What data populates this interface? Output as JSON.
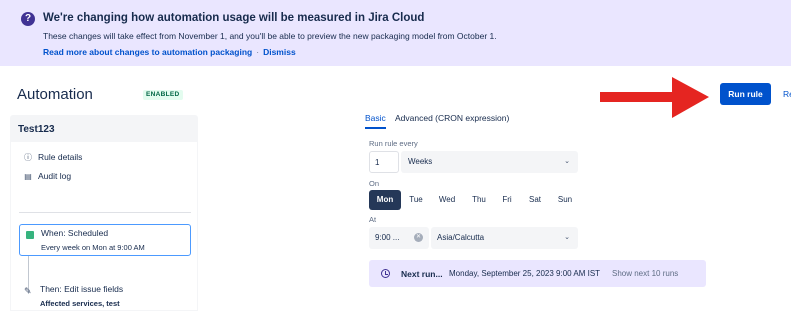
{
  "banner": {
    "icon": "question-icon",
    "title": "We're changing how automation usage will be measured in Jira Cloud",
    "description": "These changes will take effect from November 1, and you'll be able to preview the new packaging model from October 1.",
    "read_more": "Read more about changes to automation packaging",
    "separator": "·",
    "dismiss": "Dismiss"
  },
  "header": {
    "title": "Automation",
    "status": "ENABLED"
  },
  "rule": {
    "name": "Test123",
    "nav": [
      {
        "label": "Rule details",
        "icon": "info-icon"
      },
      {
        "label": "Audit log",
        "icon": "document-icon"
      }
    ],
    "trigger": {
      "title": "When: Scheduled",
      "subtitle": "Every week on Mon at 9:00 AM",
      "icon": "calendar-icon"
    },
    "action": {
      "title": "Then: Edit issue fields",
      "subtitle": "Affected services, test",
      "icon": "pencil-icon"
    }
  },
  "schedule": {
    "tabs": [
      {
        "label": "Basic",
        "active": true
      },
      {
        "label": "Advanced (CRON expression)",
        "active": false
      }
    ],
    "run_every_label": "Run rule every",
    "interval": "1",
    "unit": "Weeks",
    "on_label": "On",
    "days": [
      {
        "label": "Mon",
        "selected": true
      },
      {
        "label": "Tue",
        "selected": false
      },
      {
        "label": "Wed",
        "selected": false
      },
      {
        "label": "Thu",
        "selected": false
      },
      {
        "label": "Fri",
        "selected": false
      },
      {
        "label": "Sat",
        "selected": false
      },
      {
        "label": "Sun",
        "selected": false
      }
    ],
    "at_label": "At",
    "time": "9:00 ...",
    "timezone": "Asia/Calcutta",
    "next_run": {
      "label": "Next run...",
      "value": "Monday, September 25, 2023 9:00 AM IST",
      "show_next": "Show next 10 runs"
    }
  },
  "actions": {
    "run_rule": "Run rule",
    "cut_off": "Re"
  },
  "colors": {
    "primary": "#0052cc",
    "banner_bg": "#eae6ff",
    "selected_day": "#253858",
    "annotation": "#e52521"
  }
}
